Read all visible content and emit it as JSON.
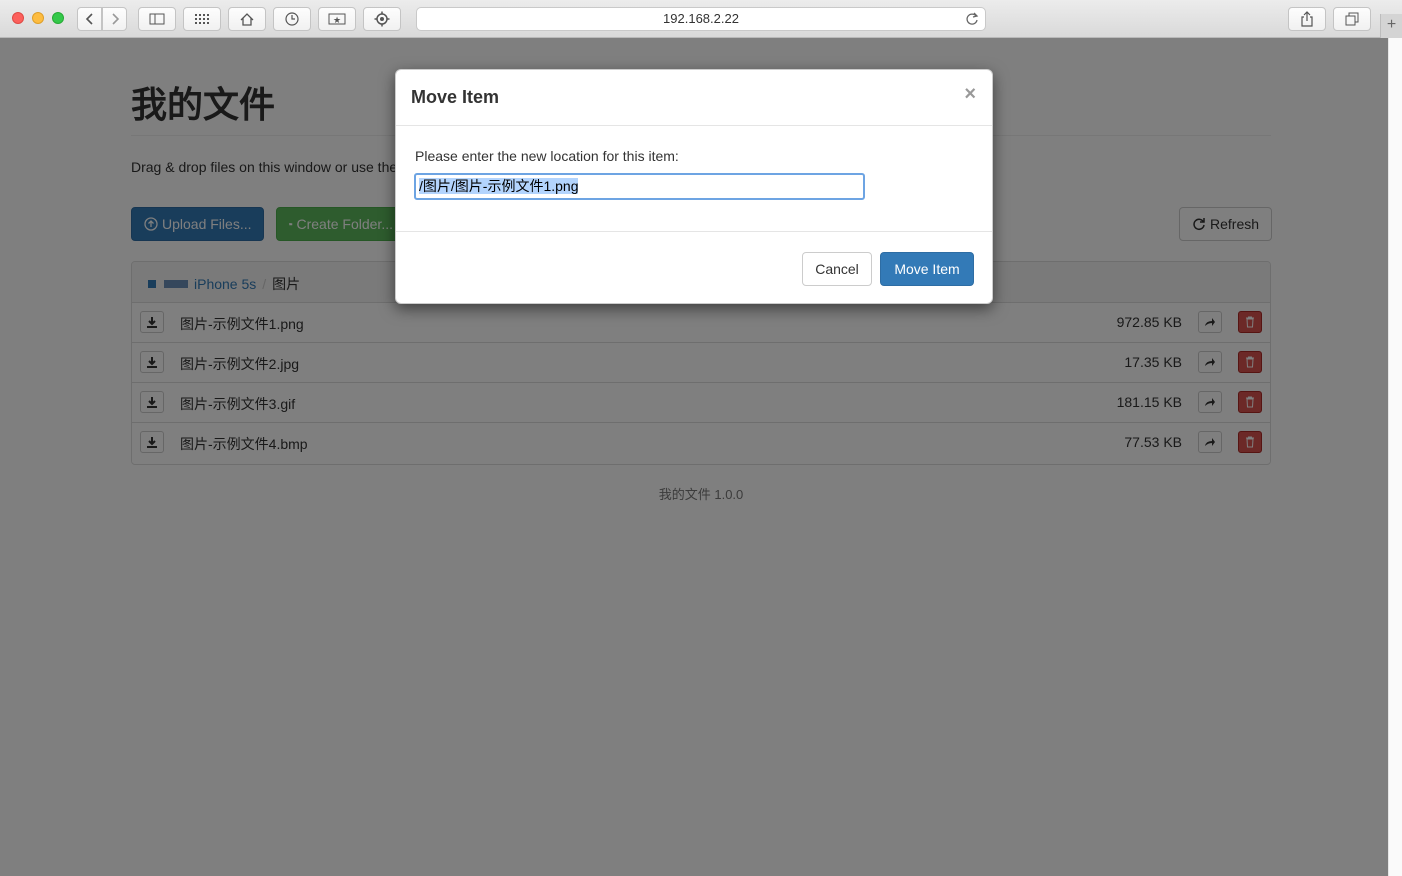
{
  "browser": {
    "url": "192.168.2.22",
    "new_tab_symbol": "+"
  },
  "page": {
    "title": "我的文件",
    "lead": "Drag & drop files on this window or use the",
    "buttons": {
      "upload": "Upload Files...",
      "create_folder": "Create Folder...",
      "refresh": "Refresh"
    },
    "breadcrumb": {
      "device": "iPhone 5s",
      "separator": "/",
      "current": "图片"
    },
    "files": [
      {
        "name": "图片-示例文件1.png",
        "size": "972.85 KB"
      },
      {
        "name": "图片-示例文件2.jpg",
        "size": "17.35 KB"
      },
      {
        "name": "图片-示例文件3.gif",
        "size": "181.15 KB"
      },
      {
        "name": "图片-示例文件4.bmp",
        "size": "77.53 KB"
      }
    ],
    "footer": "我的文件 1.0.0"
  },
  "modal": {
    "title": "Move Item",
    "close": "×",
    "prompt": "Please enter the new location for this item:",
    "input_value": "/图片/图片-示例文件1.png",
    "cancel": "Cancel",
    "confirm": "Move Item"
  },
  "colors": {
    "primary": "#337ab7",
    "success": "#5cb85c",
    "danger": "#d9534f",
    "backdrop": "rgba(0,0,0,0.5)"
  }
}
